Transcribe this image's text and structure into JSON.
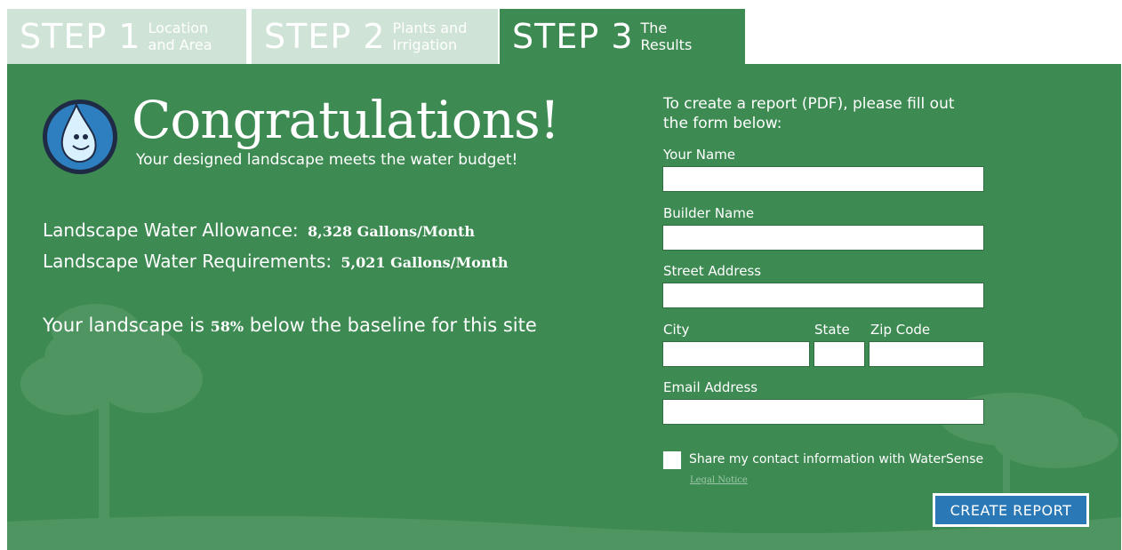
{
  "tabs": [
    {
      "step": "STEP 1",
      "sub": "Location\nand Area",
      "active": false
    },
    {
      "step": "STEP 2",
      "sub": "Plants and\nIrrigation",
      "active": false
    },
    {
      "step": "STEP 3",
      "sub": "The\nResults",
      "active": true
    }
  ],
  "results": {
    "headline": "Congratulations!",
    "subline": "Your designed landscape meets the water budget!",
    "allowance_label": "Landscape Water Allowance:",
    "allowance_value": "8,328 Gallons/Month",
    "requirements_label": "Landscape Water Requirements:",
    "requirements_value": "5,021 Gallons/Month",
    "baseline_prefix": "Your landscape is",
    "baseline_percent": "58%",
    "baseline_suffix": "below the baseline for this site"
  },
  "form": {
    "intro": "To create a report (PDF), please fill out the form below:",
    "your_name_label": "Your Name",
    "your_name_value": "",
    "builder_name_label": "Builder Name",
    "builder_name_value": "",
    "street_label": "Street Address",
    "street_value": "",
    "city_label": "City",
    "city_value": "",
    "state_label": "State",
    "state_value": "",
    "zip_label": "Zip Code",
    "zip_value": "",
    "email_label": "Email Address",
    "email_value": "",
    "share_label": "Share my contact information with WaterSense",
    "share_checked": false,
    "legal_link": "Legal Notice",
    "submit_label": "CREATE REPORT"
  },
  "colors": {
    "panel_green": "#3d8a52",
    "tab_inactive": "#cfe3d6",
    "button_blue": "#2a78b6"
  },
  "icons": {
    "mascot": "water-drop-mascot-icon"
  }
}
